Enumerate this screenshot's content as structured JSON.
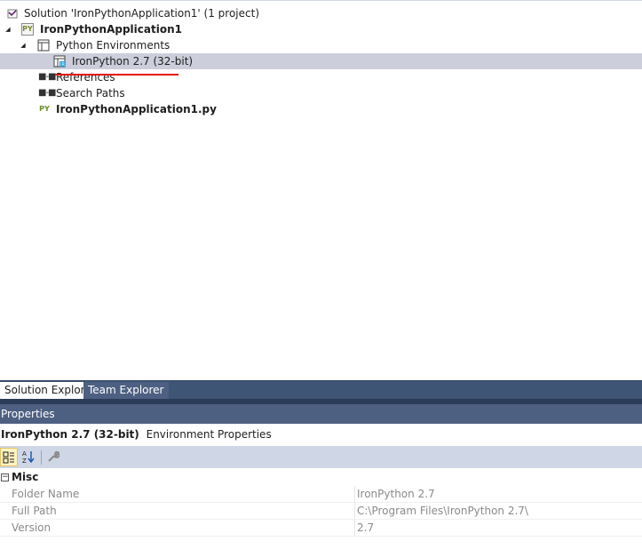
{
  "solution_explorer": {
    "solution_label": "Solution 'IronPythonApplication1' (1 project)",
    "project_label": "IronPythonApplication1",
    "python_environments_label": "Python Environments",
    "environment_label": "IronPython 2.7 (32-bit)",
    "references_label": "References",
    "search_paths_label": "Search Paths",
    "file_label": "IronPythonApplication1.py",
    "py_badge": "PY",
    "icons": {
      "solution": "visual-studio-solution-icon",
      "project": "python-project-icon",
      "environments": "python-environments-icon",
      "environment": "python-environment-icon",
      "references": "references-icon",
      "search_paths": "search-paths-icon",
      "file": "python-file-icon"
    },
    "colors": {
      "selection": "#cccedb",
      "underline": "#e51400"
    }
  },
  "tabs": {
    "active_label": "Solution Explorer",
    "inactive_label": "Team Explorer"
  },
  "properties": {
    "title": "Properties",
    "object_name": "IronPython 2.7 (32-bit)",
    "object_type": "Environment Properties",
    "toolbar": {
      "categorized_icon": "categorized-icon",
      "alphabetical_icon": "alphabetical-sort-icon",
      "property_pages_icon": "wrench-icon"
    },
    "category": "Misc",
    "rows": [
      {
        "name": "Folder Name",
        "value": "IronPython 2.7"
      },
      {
        "name": "Full Path",
        "value": "C:\\Program Files\\IronPython 2.7\\"
      },
      {
        "name": "Version",
        "value": "2.7"
      }
    ]
  }
}
